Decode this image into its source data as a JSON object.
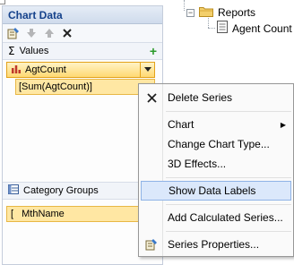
{
  "panel": {
    "title": "Chart Data",
    "toolbar": [
      {
        "icon": "properties-icon"
      },
      {
        "icon": "move-down-icon",
        "disabled": true
      },
      {
        "icon": "move-up-icon",
        "disabled": true
      },
      {
        "icon": "delete-icon"
      }
    ],
    "values_section": {
      "sigma": "Σ",
      "label": "Values",
      "add_icon": "+",
      "series": {
        "name": "AgtCount",
        "expression": "[Sum(AgtCount)]"
      }
    },
    "category_section": {
      "label": "Category Groups",
      "group": {
        "bracket": "[",
        "name": "MthName"
      }
    }
  },
  "tree": {
    "folder": {
      "expander": "⊟",
      "label": "Reports"
    },
    "report": {
      "label": "Agent Count S"
    }
  },
  "menu": {
    "delete_series": "Delete Series",
    "chart": "Chart",
    "chart_arrow": "▶",
    "change_chart_type": "Change Chart Type...",
    "effects_3d": "3D Effects...",
    "show_data_labels": "Show Data Labels",
    "add_calculated_series": "Add Calculated Series...",
    "series_properties": "Series Properties..."
  },
  "colors": {
    "highlight": "#dbe8fb",
    "selected_row": "#ffd973",
    "panel_title": "#15428b"
  }
}
